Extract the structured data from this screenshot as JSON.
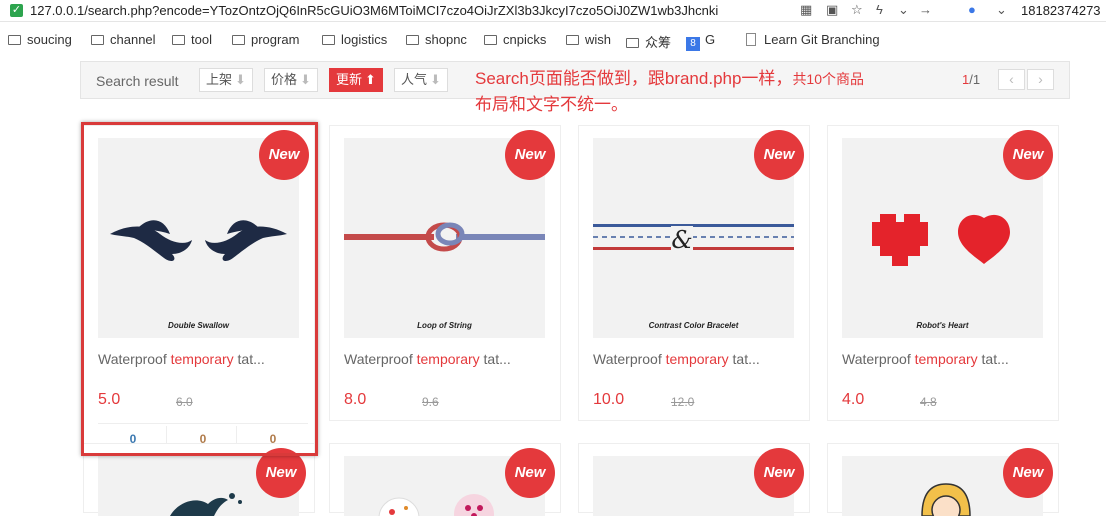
{
  "browser": {
    "url": "127.0.0.1/search.php?encode=YTozOntzOjQ6InR5cGUiO3M6MToiMCI7czo4OiJrZXl3b3JkcyI7czo5OiJ0ZW1wb3Jhcnki",
    "account": "18182374273"
  },
  "bookmarks": [
    "soucing",
    "channel",
    "tool",
    "program",
    "logistics",
    "shopnc",
    "cnpicks",
    "wish",
    "众筹",
    "G",
    "Learn Git Branching"
  ],
  "toolbar": {
    "label": "Search result",
    "sorts": [
      {
        "label": "上架",
        "arrow": "⬇"
      },
      {
        "label": "价格",
        "arrow": "⬇"
      },
      {
        "label": "更新",
        "arrow": "⬆"
      },
      {
        "label": "人气",
        "arrow": "⬇"
      }
    ]
  },
  "annotation": {
    "line1": "Search页面能否做到，跟brand.php一样，",
    "count": "共10个商品",
    "line2": "布局和文字不统一。"
  },
  "pager": {
    "current": "1",
    "sep": "/",
    "total": "1",
    "prev": "‹",
    "next": "›"
  },
  "badge_text": "New",
  "products": [
    {
      "caption": "Double Swallow",
      "title_pre": "Waterproof ",
      "title_kw": "temporary",
      "title_post": " tat...",
      "price": "5.0",
      "old_price": "6.0",
      "stats": [
        "0",
        "0",
        "0"
      ]
    },
    {
      "caption": "Loop of String",
      "title_pre": "Waterproof ",
      "title_kw": "temporary",
      "title_post": " tat...",
      "price": "8.0",
      "old_price": "9.6"
    },
    {
      "caption": "Contrast Color Bracelet",
      "title_pre": "Waterproof ",
      "title_kw": "temporary",
      "title_post": " tat...",
      "price": "10.0",
      "old_price": "12.0"
    },
    {
      "caption": "Robot's Heart",
      "title_pre": "Waterproof ",
      "title_kw": "temporary",
      "title_post": " tat...",
      "price": "4.0",
      "old_price": "4.8"
    }
  ],
  "colors": {
    "accent": "#e4393c",
    "navy": "#1e2a44",
    "blue": "#3b5a9a"
  }
}
